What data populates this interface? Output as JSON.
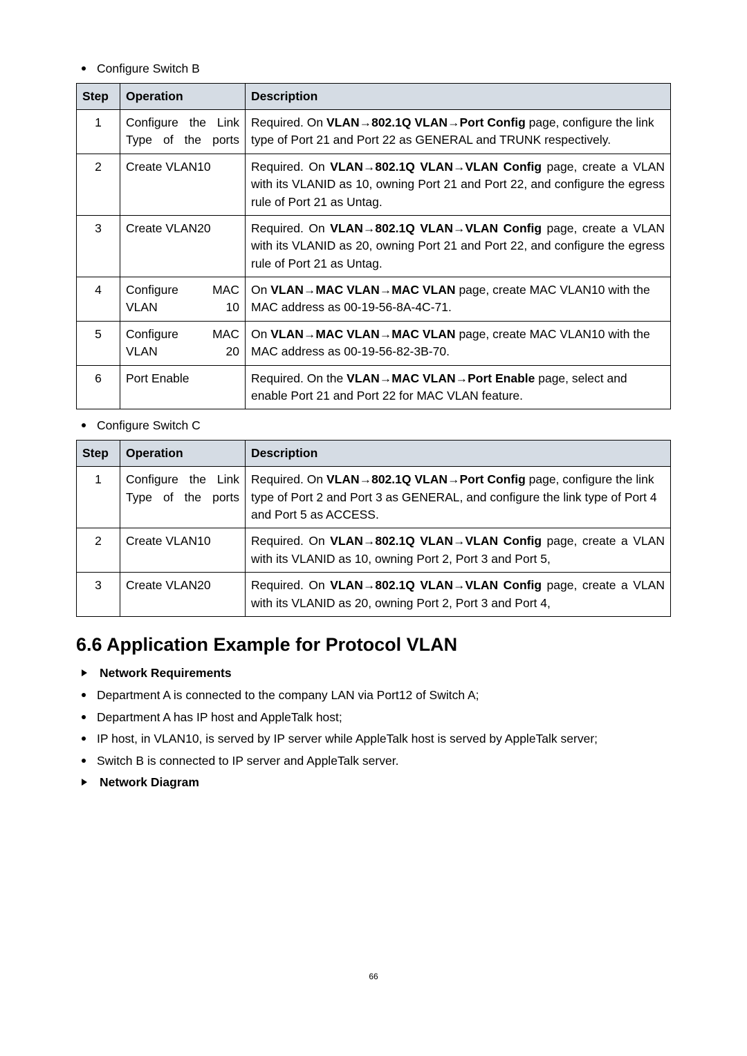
{
  "intro_bullet_b": "Configure Switch B",
  "tableB": {
    "headers": {
      "step": "Step",
      "operation": "Operation",
      "description": "Description"
    },
    "rows": [
      {
        "step": "1",
        "operation": "Configure the Link Type of the ports",
        "desc_pre": "Required. On ",
        "desc_bold": "VLAN→802.1Q VLAN→Port Config",
        "desc_post": " page, configure the link type of Port 21 and Port 22 as GENERAL and TRUNK respectively."
      },
      {
        "step": "2",
        "operation": "Create VLAN10",
        "desc_pre": "Required. On ",
        "desc_bold": "VLAN→802.1Q VLAN→VLAN Config",
        "desc_post": " page, create a VLAN with its VLANID as 10, owning Port 21 and Port 22, and configure the egress rule of Port 21 as Untag."
      },
      {
        "step": "3",
        "operation": "Create VLAN20",
        "desc_pre": "Required. On ",
        "desc_bold": "VLAN→802.1Q VLAN→VLAN Config",
        "desc_post": " page, create a VLAN with its VLANID as 20, owning Port 21 and Port 22, and configure the egress rule of Port 21 as Untag."
      },
      {
        "step": "4",
        "operation": "Configure MAC VLAN 10",
        "desc_pre": "On ",
        "desc_bold": "VLAN→MAC VLAN→MAC VLAN",
        "desc_post": " page, create MAC VLAN10 with the MAC address as 00-19-56-8A-4C-71."
      },
      {
        "step": "5",
        "operation": "Configure MAC VLAN 20",
        "desc_pre": "On ",
        "desc_bold": "VLAN→MAC VLAN→MAC VLAN",
        "desc_post": " page, create MAC VLAN10 with the MAC address as 00-19-56-82-3B-70."
      },
      {
        "step": "6",
        "operation": "Port Enable",
        "desc_pre": "Required. On the ",
        "desc_bold": "VLAN→MAC VLAN→Port Enable",
        "desc_post": " page, select and enable Port 21 and Port 22 for MAC VLAN feature."
      }
    ]
  },
  "intro_bullet_c": "Configure Switch C",
  "tableC": {
    "headers": {
      "step": "Step",
      "operation": "Operation",
      "description": "Description"
    },
    "rows": [
      {
        "step": "1",
        "operation": "Configure the Link Type of the ports",
        "desc_pre": "Required. On ",
        "desc_bold": "VLAN→802.1Q VLAN→Port Config",
        "desc_post": " page, configure the link type of Port 2 and Port 3 as GENERAL, and configure the link type of Port 4 and Port 5 as ACCESS."
      },
      {
        "step": "2",
        "operation": "Create VLAN10",
        "desc_pre": "Required. On ",
        "desc_bold": "VLAN→802.1Q VLAN→VLAN Config",
        "desc_post": " page, create a VLAN with its VLANID as 10, owning Port 2, Port 3 and Port 5,"
      },
      {
        "step": "3",
        "operation": "Create VLAN20",
        "desc_pre": "Required. On ",
        "desc_bold": "VLAN→802.1Q VLAN→VLAN Config",
        "desc_post": " page, create a VLAN with its VLANID as 20, owning Port 2, Port 3 and Port 4,"
      }
    ]
  },
  "section_heading": "6.6 Application Example for Protocol VLAN",
  "network_req_title": "Network Requirements",
  "req_bullets": [
    "Department A is connected to the company LAN via Port12 of Switch A;",
    "Department A has IP host and AppleTalk host;",
    "IP host, in VLAN10, is served by IP server while AppleTalk host is served by AppleTalk server;",
    "Switch B is connected to IP server and AppleTalk server."
  ],
  "network_diagram_title": "Network Diagram",
  "page_number": "66"
}
